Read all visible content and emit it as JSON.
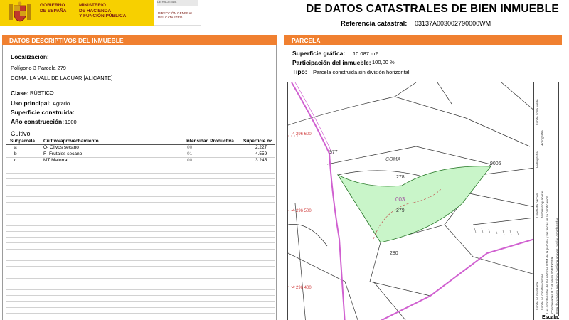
{
  "header": {
    "gov_lines": [
      "GOBIERNO",
      "DE ESPAÑA"
    ],
    "ministry_lines": [
      "MINISTERIO",
      "DE HACIENDA",
      "Y FUNCIÓN PÚBLICA"
    ],
    "sub_gov": "DE HACIENDA",
    "directorate_lines": [
      "DIRECCIÓN GENERAL",
      "DEL CATASTRO"
    ],
    "title": "DE DATOS CATASTRALES DE BIEN INMUEBLE",
    "ref_label": "Referencia catastral:",
    "ref_value": "03137A003002790000WM"
  },
  "left": {
    "section_title": "DATOS DESCRIPTIVOS DEL INMUEBLE",
    "localizacion_label": "Localización:",
    "localizacion_line1": "Polígono 3 Parcela 279",
    "localizacion_line2": "COMA. LA VALL DE LAGUAR [ALICANTE]",
    "clase_label": "Clase:",
    "clase_value": "RÚSTICO",
    "uso_label": "Uso principal:",
    "uso_value": "Agrario",
    "superficie_label": "Superficie construida:",
    "ano_label": "Año construcción:",
    "ano_value": "1900",
    "cultivo_title": "Cultivo",
    "table_headers": [
      "Subparcela",
      "Cultivo/aprovechamiento",
      "Intensidad Productiva",
      "Superficie m²"
    ],
    "rows": [
      {
        "sub": "a",
        "cultivo": "O- Olivos secano",
        "intensidad": "00",
        "superficie": "2.227"
      },
      {
        "sub": "b",
        "cultivo": "F- Frutales secano",
        "intensidad": "01",
        "superficie": "4.559"
      },
      {
        "sub": "c",
        "cultivo": "MT Matorral",
        "intensidad": "00",
        "superficie": "3.245"
      }
    ]
  },
  "right": {
    "section_title": "PARCELA",
    "sup_label": "Superficie gráfica:",
    "sup_value": "10.087 m2",
    "part_label": "Participación del inmueble:",
    "part_value": "100,00 %",
    "tipo_label": "Tipo:",
    "tipo_value": "Parcela construida sin división horizontal",
    "escala_label": "Escala:"
  },
  "map": {
    "parcel_fill": "#c9f5c9",
    "parcel_stroke": "#2a7a2a",
    "municipal_line": "#d060d0",
    "grid_text_color": "#d04040",
    "labels": {
      "north_a": "4 296 600",
      "north_b": "4 296 500",
      "north_c": "4 296 400",
      "parcel_977": "977",
      "coma": "COMA",
      "parcel_278": "278",
      "code_003": "003",
      "parcel_279": "279",
      "parcel_280": "280",
      "parcel_9006": "9006"
    }
  },
  "legend": {
    "col1": [
      "Límite de parcela",
      "Mobiliario y aceras",
      "Hidrografía",
      "Límite de manzana",
      "Límite de construcciones"
    ],
    "col2": [
      "Límite zona verde",
      "Límite de parcela",
      "Hidrografía"
    ],
    "col3": [
      "Las coordenadas de los vértices UTM de la parcela y las fincas de la certificación",
      "Coordenadas U.T.M. Huso 30 ETRS89",
      "Este documento electrónico contiene anexos con las coordenadas"
    ]
  }
}
